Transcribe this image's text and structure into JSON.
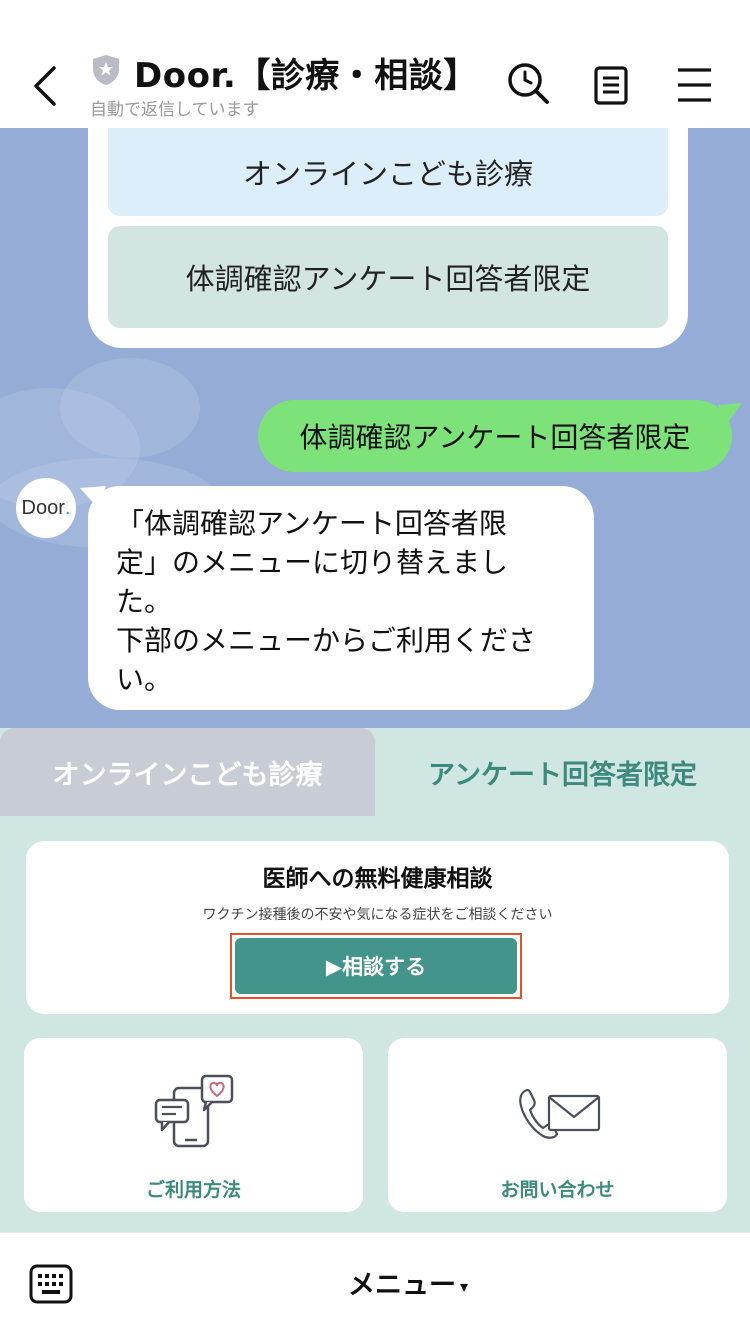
{
  "header": {
    "title": "Door.【診療・相談】",
    "subtitle": "自動で返信しています"
  },
  "chat": {
    "options": [
      {
        "label": "オンラインこども診療"
      },
      {
        "label": "体調確認アンケート回答者限定"
      }
    ],
    "user_message": "体調確認アンケート回答者限定",
    "bot_avatar_text": "Door",
    "bot_avatar_dot": ".",
    "bot_message_lines": [
      "「体調確認アンケート回答者限",
      "定」のメニューに切り替えまし",
      "た。",
      "下部のメニューからご利用くださ",
      "い。"
    ]
  },
  "rich_menu": {
    "tabs": [
      {
        "label": "オンラインこども診療",
        "active": false
      },
      {
        "label": "アンケート回答者限定",
        "active": true
      }
    ],
    "panel": {
      "title": "医師への無料健康相談",
      "subtitle": "ワクチン接種後の不安や気になる症状をご相談ください",
      "button_label": "▶相談する"
    },
    "tiles": [
      {
        "label": "ご利用方法",
        "icon": "chat-phone-icon"
      },
      {
        "label": "お問い合わせ",
        "icon": "phone-mail-icon"
      }
    ]
  },
  "bottom_bar": {
    "menu_label": "メニュー",
    "caret": "▾"
  },
  "colors": {
    "chat_background": "#94acd6",
    "user_bubble": "#7ee27a",
    "accent_teal": "#43948a",
    "highlight_frame": "#e4512f"
  }
}
